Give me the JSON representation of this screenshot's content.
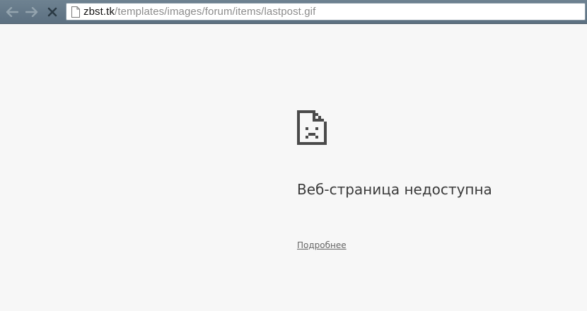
{
  "browser": {
    "nav": {
      "back_icon": "arrow-left-icon",
      "forward_icon": "arrow-right-icon",
      "stop_icon": "close-icon"
    },
    "address_bar": {
      "domain": "zbst.tk",
      "path": "/templates/images/forum/items/lastpost.gif",
      "page_icon": "page-icon"
    }
  },
  "error_page": {
    "icon": "sad-document-icon",
    "title": "Веб-страница недоступна",
    "details_link": "Подробнее"
  },
  "colors": {
    "page_background": "#f7f7f7",
    "toolbar": "#6e8291",
    "title_text": "#3a3a3a"
  }
}
